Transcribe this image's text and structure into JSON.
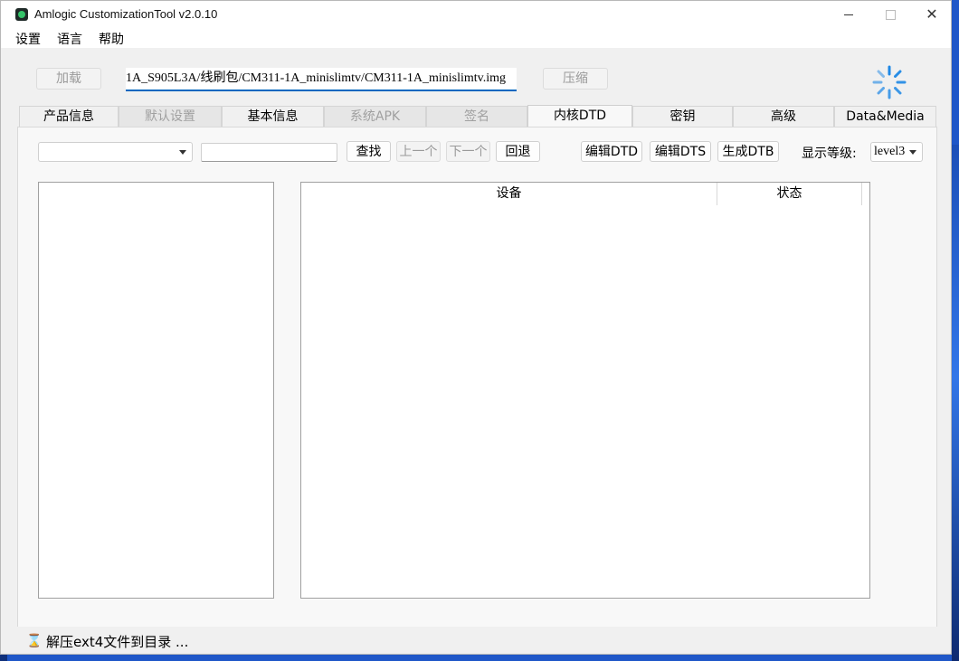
{
  "window": {
    "title": "Amlogic CustomizationTool v2.0.10",
    "app_icon": "app-logo-icon"
  },
  "menu": {
    "items": [
      "设置",
      "语言",
      "帮助"
    ]
  },
  "toolbar": {
    "load_label": "加载",
    "path_value": "1A_S905L3A/线刷包/CM311-1A_minislimtv/CM311-1A_minislimtv.img",
    "compress_label": "压缩",
    "spinner_icon": "loading-spinner-icon",
    "accent_color": "#0067c0"
  },
  "tabs": [
    {
      "label": "产品信息",
      "state": "normal"
    },
    {
      "label": "默认设置",
      "state": "disabled"
    },
    {
      "label": "基本信息",
      "state": "normal"
    },
    {
      "label": "系统APK",
      "state": "disabled"
    },
    {
      "label": "签名",
      "state": "disabled"
    },
    {
      "label": "内核DTD",
      "state": "active"
    },
    {
      "label": "密钥",
      "state": "normal"
    },
    {
      "label": "高级",
      "state": "normal"
    },
    {
      "label": "Data&Media",
      "state": "normal"
    }
  ],
  "dtd": {
    "node_select_value": "",
    "search_value": "",
    "find_label": "查找",
    "prev_label": "上一个",
    "next_label": "下一个",
    "back_label": "回退",
    "edit_dtd_label": "编辑DTD",
    "edit_dts_label": "编辑DTS",
    "gen_dtb_label": "生成DTB",
    "level_label": "显示等级:",
    "level_value": "level3",
    "table_headers": [
      "设备",
      "状态"
    ]
  },
  "status": {
    "icon": "hourglass-icon",
    "text": "解压ext4文件到目录 ..."
  }
}
